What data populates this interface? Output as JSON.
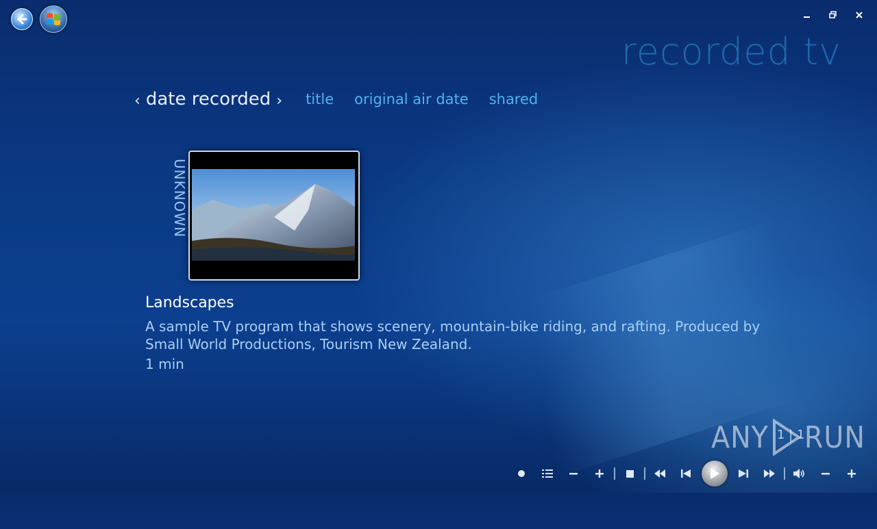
{
  "app_title": "recorded tv",
  "pivots": {
    "current": "date recorded",
    "items": [
      "title",
      "original air date",
      "shared"
    ]
  },
  "group_label": "UNKNOWN",
  "program": {
    "title": "Landscapes",
    "description": "A sample TV program that shows scenery, mountain-bike riding, and rafting. Produced by Small World Productions, Tourism New Zealand.",
    "duration": "1 min"
  },
  "watermark": {
    "left": "ANY",
    "right": "RUN",
    "counter": "1 | 1"
  },
  "icons": {
    "back": "back-arrow-icon",
    "start": "windows-logo-icon",
    "minimize": "minimize-icon",
    "restore": "restore-icon",
    "close": "close-icon"
  },
  "colors": {
    "pivot": "#4eb3ef",
    "title": "#1f69ad",
    "desc": "#a9d0f3"
  }
}
